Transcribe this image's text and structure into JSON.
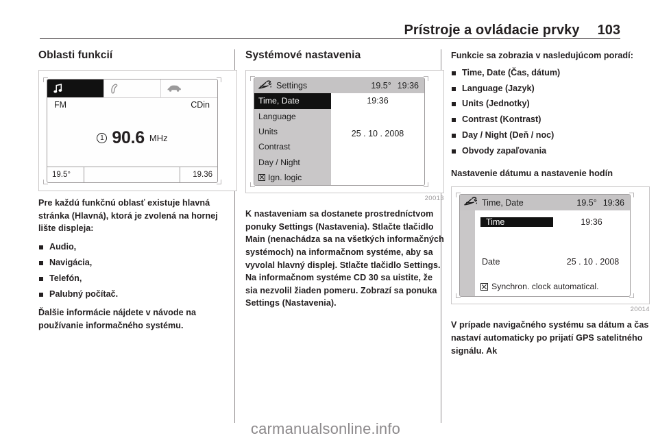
{
  "header": {
    "title": "Prístroje a ovládacie prvky",
    "page_number": "103"
  },
  "left_column": {
    "heading": "Oblasti funkcií",
    "figure_radio": {
      "tabs": [
        {
          "icon": "music-note-icon",
          "active": true
        },
        {
          "icon": "phone-handset-icon",
          "active": false
        },
        {
          "icon": "car-icon",
          "active": false
        }
      ],
      "source_left": "FM",
      "source_right": "CDin",
      "preset_number": "1",
      "frequency": "90.6",
      "frequency_unit": "MHz",
      "status_temperature": "19.5°",
      "status_clock": "19.36"
    },
    "paragraph_1": "Pre každú funkčnú oblasť existuje hlavná stránka (Hlavná), ktorá je zvolená na hornej lište displeja:",
    "bullets": [
      "Audio,",
      "Navigácia,",
      "Telefón,",
      "Palubný počítač."
    ],
    "paragraph_2": "Ďalšie informácie nájdete v návode na používanie informačného systému."
  },
  "middle_column": {
    "heading": "Systémové nastavenia",
    "figure_settings": {
      "title_icon": "settings-wrench-icon",
      "title": "Settings",
      "status_temperature": "19.5°",
      "status_clock": "19:36",
      "items": [
        {
          "label": "Time, Date",
          "selected": true,
          "checkbox": false
        },
        {
          "label": "Language",
          "selected": false,
          "checkbox": false
        },
        {
          "label": "Units",
          "selected": false,
          "checkbox": false
        },
        {
          "label": "Contrast",
          "selected": false,
          "checkbox": false
        },
        {
          "label": "Day / Night",
          "selected": false,
          "checkbox": false
        },
        {
          "label": "Ign. logic",
          "selected": false,
          "checkbox": true
        }
      ],
      "value_time": "19:36",
      "value_date": "25 . 10 . 2008",
      "figure_number": "20013"
    },
    "paragraph_1": "K nastaveniam sa dostanete prostredníctvom ponuky Settings (Nastavenia). Stlačte tlačidlo Main (nenachádza sa na všetkých informačných systémoch) na informačnom systéme, aby sa vyvolal hlavný displej. Stlačte tlačidlo Settings. Na informačnom systéme CD 30 sa uistite, že sia nezvolil žiaden pomeru. Zobrazí sa ponuka Settings (Nastavenia)."
  },
  "right_column": {
    "intro": "Funkcie sa zobrazia v nasledujúcom poradí:",
    "bullets": [
      "Time, Date (Čas, dátum)",
      "Language (Jazyk)",
      "Units (Jednotky)",
      "Contrast (Kontrast)",
      "Day / Night (Deň / noc)",
      "Obvody zapaľovania"
    ],
    "subheading": "Nastavenie dátumu a nastavenie hodín",
    "figure_timedate": {
      "title_icon": "settings-wrench-icon",
      "title": "Time, Date",
      "status_temperature": "19.5°",
      "status_clock": "19:36",
      "row_time_label": "Time",
      "row_time_value": "19:36",
      "row_date_label": "Date",
      "row_date_value": "25 . 10 . 2008",
      "sync_label": "Synchron. clock automatical.",
      "figure_number": "20014"
    },
    "paragraph_1": "V prípade navigačného systému sa dátum a čas nastaví automaticky po prijatí GPS satelitného signálu. Ak"
  },
  "footer": {
    "watermark": "carmanualsonline.info"
  },
  "colors": {
    "text": "#231f20",
    "rule": "#4a4446",
    "screen_gray": "#c9c7c8",
    "selection_black": "#111111",
    "watermark_gray": "#8d8a8c"
  }
}
